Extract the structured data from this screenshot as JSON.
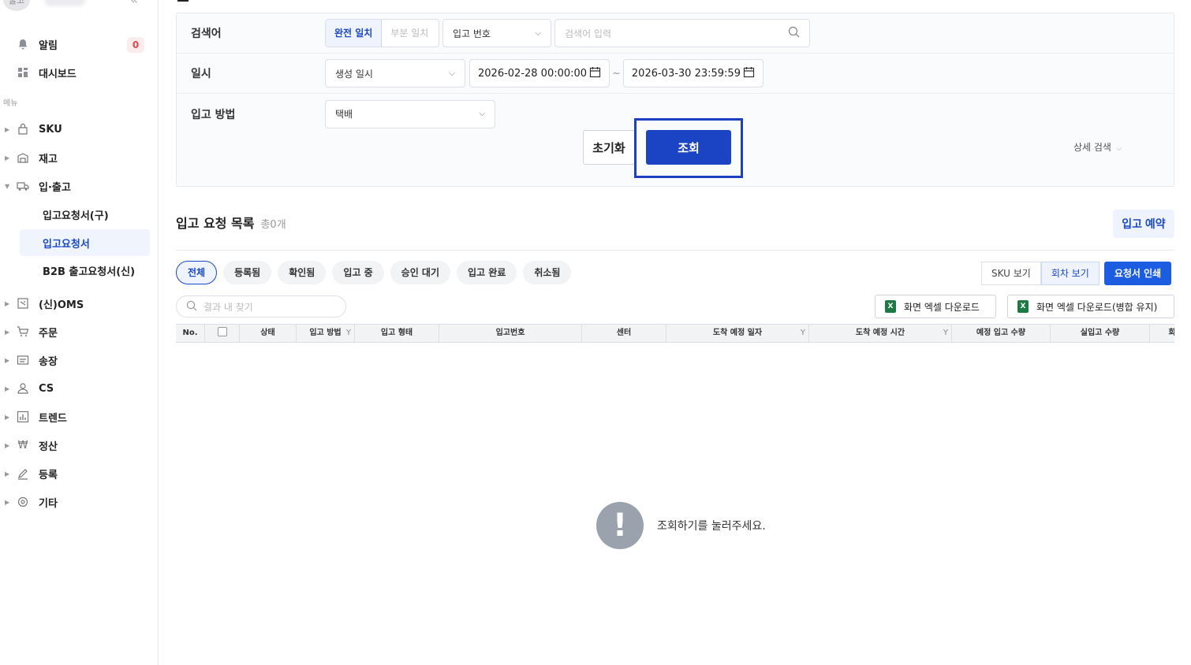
{
  "sidebar": {
    "avatar_text": "물고",
    "collapse_icon": "double-chevron-left-icon",
    "alerts": {
      "label": "알림",
      "count": "0"
    },
    "dashboard": {
      "label": "대시보드"
    },
    "menu_section": "메뉴",
    "items": [
      {
        "label": "SKU",
        "icon": "bag-icon"
      },
      {
        "label": "재고",
        "icon": "warehouse-icon"
      },
      {
        "label": "입·출고",
        "icon": "truck-icon"
      },
      {
        "label": "(신)OMS",
        "icon": "oms-icon"
      },
      {
        "label": "주문",
        "icon": "cart-icon"
      },
      {
        "label": "송장",
        "icon": "invoice-icon"
      },
      {
        "label": "CS",
        "icon": "person-icon"
      },
      {
        "label": "트렌드",
        "icon": "bar-chart-icon"
      },
      {
        "label": "정산",
        "icon": "won-icon"
      },
      {
        "label": "등록",
        "icon": "pencil-icon"
      },
      {
        "label": "기타",
        "icon": "gear-icon"
      }
    ],
    "subitems": [
      {
        "label": "입고요청서(구)"
      },
      {
        "label": "입고요청서",
        "active": true
      },
      {
        "label": "B2B 출고요청서(신)"
      }
    ]
  },
  "filter": {
    "keyword": {
      "label": "검색어",
      "match_exact": "완전 일치",
      "match_partial": "부분 일치",
      "field_select": "입고 번호",
      "input_placeholder": "검색어 입력"
    },
    "date": {
      "label": "일시",
      "type_select": "생성 일시",
      "start": "2026-02-28 00:00:00",
      "separator": "~",
      "end": "2026-03-30 23:59:59"
    },
    "method": {
      "label": "입고 방법",
      "value": "택배"
    },
    "reset_label": "초기화",
    "search_label": "조회",
    "detail_label": "상세 검색"
  },
  "list": {
    "title": "입고 요청 목록",
    "count": "총0개",
    "reserve_label": "입고 예약",
    "chips": [
      "전체",
      "등록됨",
      "확인됨",
      "입고 중",
      "승인 대기",
      "입고 완료",
      "취소됨"
    ],
    "view_sku": "SKU 보기",
    "view_truck": "회차 보기",
    "print_label": "요청서 인쇄",
    "find_placeholder": "결과 내 찾기",
    "excel_download": "화면 엑셀 다운로드",
    "excel_download_merge": "화면 엑셀 다운로드(병합 유지)",
    "columns": [
      "No.",
      "상태",
      "입고 방법",
      "입고 형태",
      "입고번호",
      "센터",
      "도착 예정 일자",
      "도착 예정 시간",
      "예정 입고 수량",
      "실입고 수량",
      "회:"
    ],
    "empty_message": "조회하기를 눌러주세요."
  }
}
